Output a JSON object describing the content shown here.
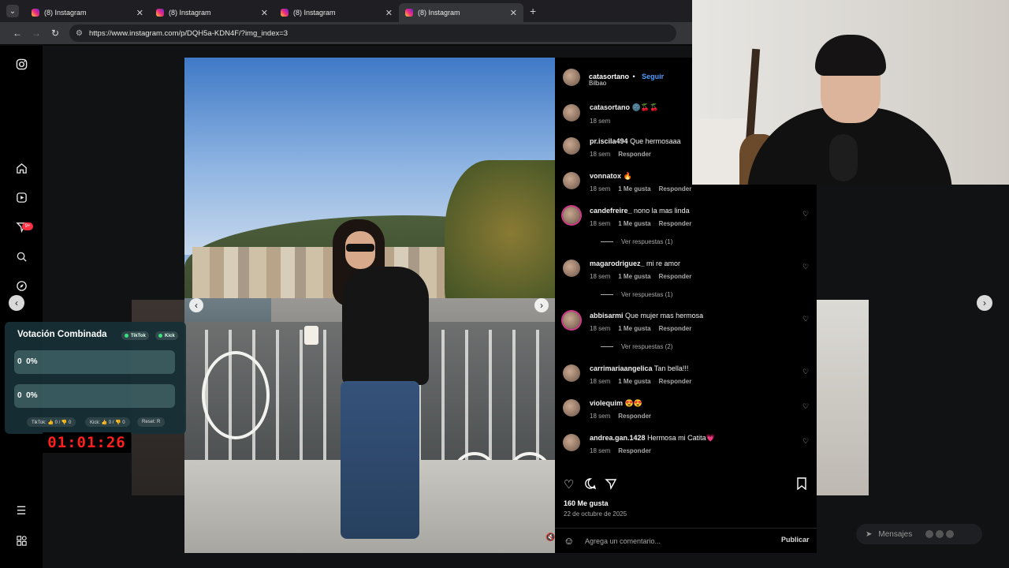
{
  "browser": {
    "tabs": [
      {
        "title": "(8) Instagram",
        "active": false
      },
      {
        "title": "(8) Instagram",
        "active": false
      },
      {
        "title": "(8) Instagram",
        "active": false
      },
      {
        "title": "(8) Instagram",
        "active": true
      }
    ],
    "url": "https://www.instagram.com/p/DQH5a-KDN4F/?img_index=3"
  },
  "sidebar": {
    "icons": [
      "instagram-logo-icon",
      "home-icon",
      "reels-icon",
      "direct-icon",
      "search-icon",
      "explore-icon",
      "notifications-icon",
      "menu-icon",
      "apps-icon"
    ],
    "badge": "9+"
  },
  "post": {
    "author": "catasortano",
    "follow_label": "Seguir",
    "separator": "•",
    "location": "Bilbao",
    "caption_author": "catasortano",
    "caption_text": "🌚🍒🍒",
    "caption_time": "18 sem",
    "likes": "160 Me gusta",
    "date": "22 de octubre de 2025",
    "add_comment_placeholder": "Agrega un comentario...",
    "publish_label": "Publicar"
  },
  "comments": [
    {
      "user": "pr.iscila494",
      "text": "Que hermosaaa",
      "time": "18 sem",
      "likes": "",
      "reply": "Responder",
      "replies": ""
    },
    {
      "user": "vonnatox",
      "text": "🔥",
      "time": "18 sem",
      "likes": "1 Me gusta",
      "reply": "Responder",
      "replies": ""
    },
    {
      "user": "candefreire_",
      "text": "nono la mas linda",
      "time": "18 sem",
      "likes": "1 Me gusta",
      "reply": "Responder",
      "replies": "Ver respuestas (1)"
    },
    {
      "user": "magarodriguez_",
      "text": "mi re amor",
      "time": "18 sem",
      "likes": "1 Me gusta",
      "reply": "Responder",
      "replies": "Ver respuestas (1)"
    },
    {
      "user": "abbisarmi",
      "text": "Que mujer mas hermosa",
      "time": "18 sem",
      "likes": "1 Me gusta",
      "reply": "Responder",
      "replies": "Ver respuestas (2)"
    },
    {
      "user": "carrimariaangelica",
      "text": "Tan bella!!!",
      "time": "18 sem",
      "likes": "1 Me gusta",
      "reply": "Responder",
      "replies": ""
    },
    {
      "user": "violequim",
      "text": "😍😍",
      "time": "18 sem",
      "likes": "",
      "reply": "Responder",
      "replies": ""
    },
    {
      "user": "andrea.gan.1428",
      "text": "Hermosa mi Catita💗",
      "time": "18 sem",
      "likes": "",
      "reply": "Responder",
      "replies": ""
    }
  ],
  "vote_overlay": {
    "title": "Votación Combinada",
    "tags": [
      "TikTok",
      "Kick"
    ],
    "options": [
      {
        "count": "0",
        "percent": "0%",
        "fill": 0
      },
      {
        "count": "0",
        "percent": "0%",
        "fill": 0
      }
    ],
    "stats": [
      "TikTok: 👍 0 / 👎 0",
      "Kick: 👍 0 / 👎 0",
      "Reset: R"
    ],
    "timer": "01:01:26"
  },
  "messages": {
    "label": "Mensajes"
  },
  "colors": {
    "accent": "#4a9fff",
    "background": "#000000",
    "timer": "#ff1f1f"
  }
}
